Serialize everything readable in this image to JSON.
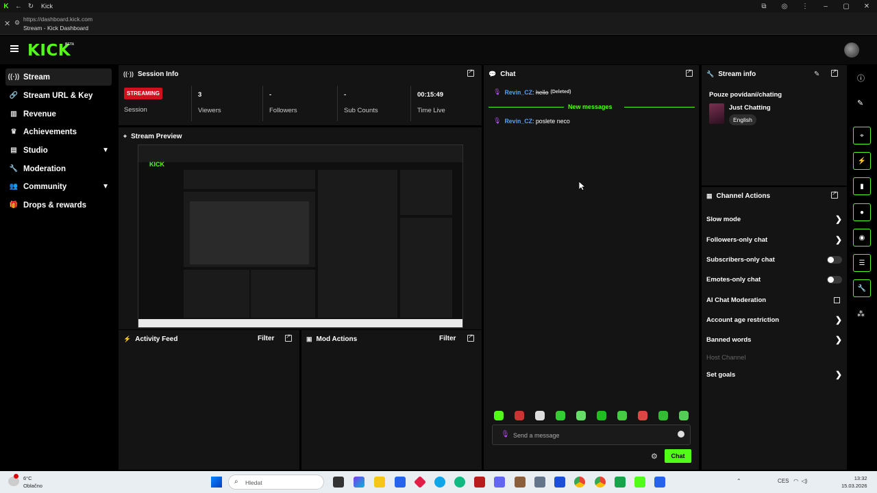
{
  "browser": {
    "tab_title": "Kick",
    "url": "https://dashboard.kick.com",
    "page_title": "Stream - Kick Dashboard"
  },
  "header": {
    "logo": "KICK",
    "beta": "BETA"
  },
  "sidebar": {
    "items": [
      {
        "label": "Stream",
        "icon": "broadcast-icon"
      },
      {
        "label": "Stream URL & Key",
        "icon": "link-icon"
      },
      {
        "label": "Revenue",
        "icon": "chart-icon"
      },
      {
        "label": "Achievements",
        "icon": "trophy-icon"
      },
      {
        "label": "Studio",
        "icon": "studio-icon"
      },
      {
        "label": "Moderation",
        "icon": "wrench-icon"
      },
      {
        "label": "Community",
        "icon": "community-icon"
      },
      {
        "label": "Drops & rewards",
        "icon": "gift-icon"
      }
    ]
  },
  "session": {
    "title": "Session Info",
    "status": "STREAMING",
    "status_label": "Session",
    "viewers_value": "3",
    "viewers_label": "Viewers",
    "followers_value": "-",
    "followers_label": "Followers",
    "subs_value": "-",
    "subs_label": "Sub Counts",
    "time_value": "00:15:49",
    "time_label": "Time Live"
  },
  "preview": {
    "title": "Stream Preview"
  },
  "activity": {
    "title": "Activity Feed",
    "filter": "Filter"
  },
  "mod": {
    "title": "Mod Actions",
    "filter": "Filter"
  },
  "chat": {
    "title": "Chat",
    "messages": [
      {
        "user": "Revin_CZ",
        "text": "hello",
        "deleted_note": "(Deleted)"
      },
      {
        "user": "Revin_CZ",
        "text": "poslete neco"
      }
    ],
    "new_messages": "New messages",
    "input_placeholder": "Send a message",
    "send_label": "Chat"
  },
  "stream_info": {
    "title": "Stream info",
    "stream_title": "Pouze povídaní/chating",
    "category": "Just Chatting",
    "language": "English"
  },
  "channel_actions": {
    "title": "Channel Actions",
    "items": [
      {
        "label": "Slow mode"
      },
      {
        "label": "Followers-only chat"
      },
      {
        "label": "Subscribers-only chat"
      },
      {
        "label": "Emotes-only chat"
      },
      {
        "label": "AI Chat Moderation"
      },
      {
        "label": "Account age restriction"
      },
      {
        "label": "Banned words"
      },
      {
        "label": "Host Channel"
      },
      {
        "label": "Set goals"
      }
    ]
  },
  "taskbar": {
    "weather_temp": "6°C",
    "weather_desc": "Oblačno",
    "search_placeholder": "Hledat",
    "lang": "CES",
    "time": "13:32",
    "date": "15.03.2026"
  },
  "colors": {
    "accent": "#53fc18",
    "streaming": "#d0101d",
    "username": "#4ea3ff",
    "mic": "#b44bff"
  }
}
